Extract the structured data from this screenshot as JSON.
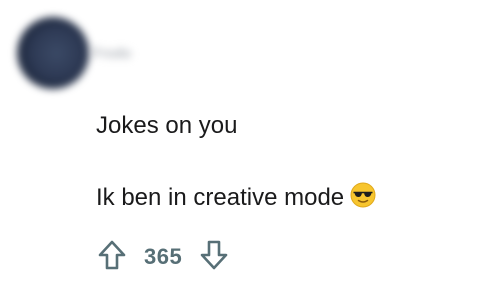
{
  "comment": {
    "author": "Frodo",
    "lines": [
      "Jokes on you",
      "Ik ben in creative mode"
    ],
    "emoji": "smiling-face-with-sunglasses",
    "score": "365"
  },
  "icons": {
    "upvote": "arrow-up-outline-icon",
    "downvote": "arrow-down-outline-icon"
  },
  "colors": {
    "text": "#1a1a1b",
    "vote_icon": "#576f76"
  }
}
